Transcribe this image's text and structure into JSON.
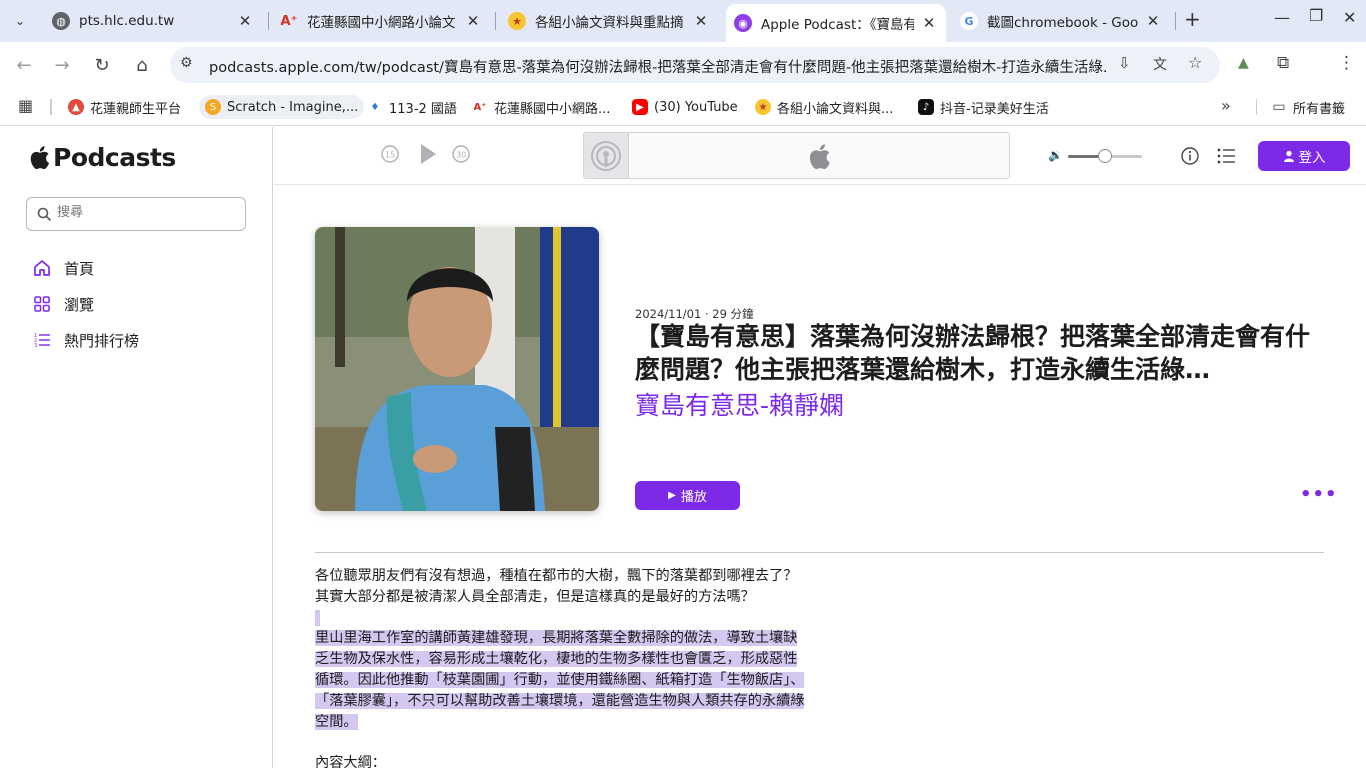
{
  "browser": {
    "tabs": [
      {
        "title": "pts.hlc.edu.tw",
        "icon": "globe-icon",
        "active": false
      },
      {
        "title": "花蓮縣國中小網路小論文",
        "icon": "a-plus-icon",
        "active": false
      },
      {
        "title": "各組小論文資料與重點摘",
        "icon": "star-eyes-emoji-icon",
        "active": false
      },
      {
        "title": "Apple Podcast：《寶島有",
        "icon": "podcasts-icon",
        "active": true
      },
      {
        "title": "截圖chromebook - Google",
        "icon": "google-icon",
        "active": false
      }
    ],
    "url": "podcasts.apple.com/tw/podcast/寶島有意思-落葉為何沒辦法歸根-把落葉全部清走會有什麼問題-他主張把落葉還給樹木-打造永續生活綠...",
    "bookmarks": [
      {
        "label": "花蓮親師生平台",
        "icon": "school-icon"
      },
      {
        "label": "Scratch - Imagine,...",
        "icon": "scratch-icon"
      },
      {
        "label": "113-2 國語",
        "icon": "bird-icon"
      },
      {
        "label": "花蓮縣國中小網路...",
        "icon": "a-plus-icon"
      },
      {
        "label": "(30) YouTube",
        "icon": "youtube-icon"
      },
      {
        "label": "各組小論文資料與...",
        "icon": "star-eyes-emoji-icon"
      },
      {
        "label": "抖音-记录美好生活",
        "icon": "tiktok-icon"
      }
    ],
    "all_bookmarks_label": "所有書籤",
    "more_bookmarks": "»"
  },
  "sidebar": {
    "brand": "Podcasts",
    "search_placeholder": "搜尋",
    "items": [
      {
        "label": "首頁",
        "icon": "home-icon"
      },
      {
        "label": "瀏覽",
        "icon": "browse-grid-icon"
      },
      {
        "label": "熱門排行榜",
        "icon": "charts-list-icon"
      }
    ]
  },
  "player": {
    "signin_label": "登入",
    "volume_level": 0.5
  },
  "episode": {
    "meta": "2024/11/01 · 29 分鐘",
    "title": "【寶島有意思】落葉為何沒辦法歸根？把落葉全部清走會有什麼問題？他主張把落葉還給樹木，打造永續生活綠…",
    "show": "寶島有意思-賴靜嫻",
    "play_label": "播放",
    "more": "•••",
    "description": {
      "p1_line1": "各位聽眾朋友們有沒有想過，種植在都市的大樹，飄下的落葉都到哪裡去了？",
      "p1_line2": "其實大部分都是被清潔人員全部清走，但是這樣真的是最好的方法嗎？",
      "p2_line1": "里山里海工作室的講師黃建雄發現，長期將落葉全數掃除的做法，導致土壤缺",
      "p2_line2": "乏生物及保水性，容易形成土壤乾化，棲地的生物多樣性也會匱乏，形成惡性",
      "p2_line3": "循環。因此他推動「枝葉園圃」行動，並使用鐵絲圈、紙箱打造「生物飯店」、",
      "p2_line4": "「落葉膠囊」，不只可以幫助改善土壤環境，還能營造生物與人類共存的永續綠",
      "p2_line5": "空間。",
      "p3": "內容大綱："
    }
  },
  "colors": {
    "accent": "#7d2ae8",
    "tabstrip": "#e2e8f6",
    "highlight": "#d4c8f0"
  }
}
